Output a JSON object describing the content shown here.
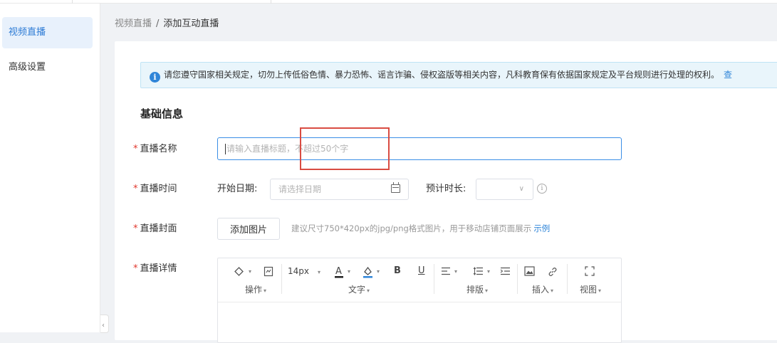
{
  "sidebar": {
    "items": [
      {
        "label": "视频直播",
        "active": true
      },
      {
        "label": "高级设置",
        "active": false
      }
    ],
    "collapse_glyph": "‹"
  },
  "breadcrumb": {
    "parent": "视频直播",
    "separator": "/",
    "current": "添加互动直播"
  },
  "notice": {
    "icon": "info-icon",
    "text": "请您遵守国家相关规定，切勿上传低俗色情、暴力恐怖、谣言诈骗、侵权盗版等相关内容，凡科教育保有依据国家规定及平台规则进行处理的权利。",
    "link": "查"
  },
  "form": {
    "section_title": "基础信息",
    "required_mark": "*",
    "name": {
      "label": "直播名称",
      "value": "",
      "placeholder": "请输入直播标题，不超过50个字"
    },
    "time": {
      "label": "直播时间",
      "start_label": "开始日期:",
      "date_placeholder": "请选择日期",
      "duration_label": "预计时长:",
      "duration_value": ""
    },
    "cover": {
      "label": "直播封面",
      "button": "添加图片",
      "hint": "建议尺寸750*420px的jpg/png格式图片，用于移动店铺页面展示",
      "example_link": "示例"
    },
    "detail": {
      "label": "直播详情",
      "toolbar": {
        "font_size": "14px",
        "bold": "B",
        "underline": "U",
        "groups": [
          "操作",
          "文字",
          "排版",
          "插入",
          "视图"
        ]
      }
    }
  },
  "colors": {
    "accent": "#2d7bd5",
    "required": "#e0352b",
    "highlight_box": "#d94c42",
    "notice_bg": "#e9f5fb"
  }
}
